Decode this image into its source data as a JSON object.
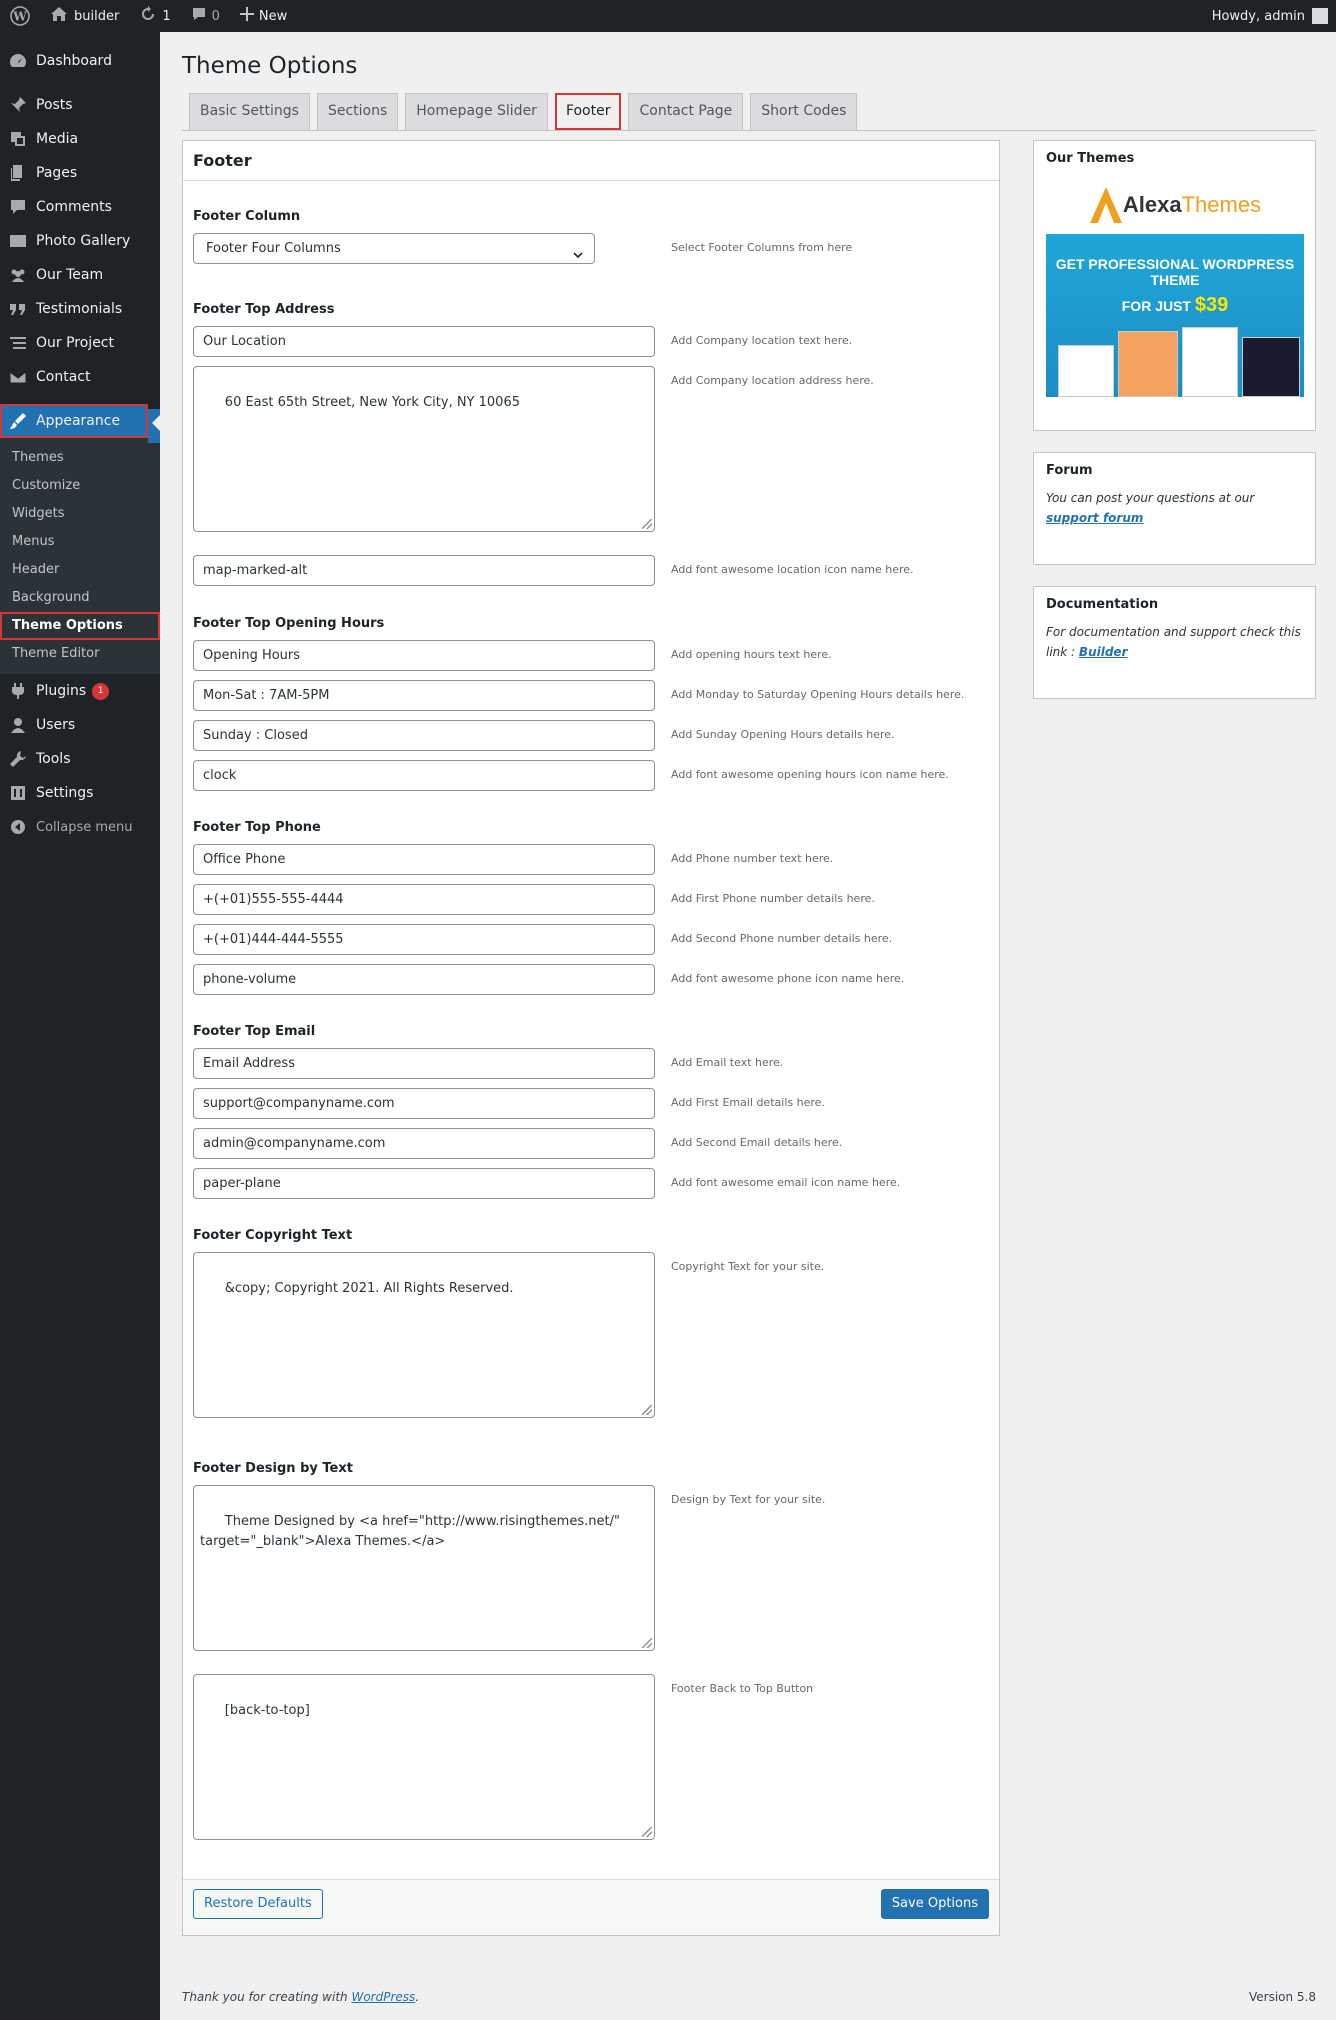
{
  "adminbar": {
    "site_name": "builder",
    "updates_count": "1",
    "comments_count": "0",
    "new_label": "New",
    "howdy": "Howdy, admin"
  },
  "sidebar": {
    "items": [
      {
        "label": "Dashboard",
        "icon": "dashboard-icon"
      },
      {
        "label": "Posts",
        "icon": "pin-icon"
      },
      {
        "label": "Media",
        "icon": "media-icon"
      },
      {
        "label": "Pages",
        "icon": "pages-icon"
      },
      {
        "label": "Comments",
        "icon": "comment-icon"
      },
      {
        "label": "Photo Gallery",
        "icon": "gallery-icon"
      },
      {
        "label": "Our Team",
        "icon": "team-icon"
      },
      {
        "label": "Testimonials",
        "icon": "quote-icon"
      },
      {
        "label": "Our Project",
        "icon": "list-icon"
      },
      {
        "label": "Contact",
        "icon": "email-icon"
      },
      {
        "label": "Appearance",
        "icon": "brush-icon"
      }
    ],
    "appearance_sub": [
      "Themes",
      "Customize",
      "Widgets",
      "Menus",
      "Header",
      "Background",
      "Theme Options",
      "Theme Editor"
    ],
    "lower_items": [
      {
        "label": "Plugins",
        "badge": "1"
      },
      {
        "label": "Users"
      },
      {
        "label": "Tools"
      },
      {
        "label": "Settings"
      }
    ],
    "collapse": "Collapse menu"
  },
  "page": {
    "title": "Theme Options",
    "tabs": [
      "Basic Settings",
      "Sections",
      "Homepage Slider",
      "Footer",
      "Contact Page",
      "Short Codes"
    ],
    "active_tab": "Footer"
  },
  "panel": {
    "heading": "Footer",
    "footer_column": {
      "label": "Footer Column",
      "value": "Footer Four Columns",
      "desc": "Select Footer Columns from here"
    },
    "address": {
      "label": "Footer Top Address",
      "text": "Our Location",
      "text_desc": "Add Company location text here.",
      "address": "60 East 65th Street, New York City, NY 10065",
      "address_desc": "Add Company location address here.",
      "icon": "map-marked-alt",
      "icon_desc": "Add font awesome location icon name here."
    },
    "hours": {
      "label": "Footer Top Opening Hours",
      "text": "Opening Hours",
      "text_desc": "Add opening hours text here.",
      "weekday": "Mon-Sat : 7AM-5PM",
      "weekday_desc": "Add Monday to Saturday Opening Hours details here.",
      "sunday": "Sunday : Closed",
      "sunday_desc": "Add Sunday Opening Hours details here.",
      "icon": "clock",
      "icon_desc": "Add font awesome opening hours icon name here."
    },
    "phone": {
      "label": "Footer Top Phone",
      "text": "Office Phone",
      "text_desc": "Add Phone number text here.",
      "first": "+(+01)555-555-4444",
      "first_desc": "Add First Phone number details here.",
      "second": "+(+01)444-444-5555",
      "second_desc": "Add Second Phone number details here.",
      "icon": "phone-volume",
      "icon_desc": "Add font awesome phone icon name here."
    },
    "email": {
      "label": "Footer Top Email",
      "text": "Email Address",
      "text_desc": "Add Email text here.",
      "first": "support@companyname.com",
      "first_desc": "Add First Email details here.",
      "second": "admin@companyname.com",
      "second_desc": "Add Second Email details here.",
      "icon": "paper-plane",
      "icon_desc": "Add font awesome email icon name here."
    },
    "copyright": {
      "label": "Footer Copyright Text",
      "value": "&copy; Copyright 2021. All Rights Reserved.",
      "desc": "Copyright Text for your site."
    },
    "design_by": {
      "label": "Footer Design by Text",
      "value": "Theme Designed by <a href=\"http://www.risingthemes.net/\"\ntarget=\"_blank\">Alexa Themes.</a>",
      "desc": "Design by Text for your site."
    },
    "back_to_top": {
      "value": "[back-to-top]",
      "desc": "Footer Back to Top Button"
    },
    "restore_label": "Restore Defaults",
    "save_label": "Save Options"
  },
  "side": {
    "themes_title": "Our Themes",
    "logo_part1": "Alexa",
    "logo_part2": "Themes",
    "banner_line1": "GET PROFESSIONAL WORDPRESS THEME",
    "banner_line2": "FOR JUST",
    "banner_price": "$39",
    "forum_title": "Forum",
    "forum_text": "You can post your questions at our",
    "forum_link": "support forum",
    "docs_title": "Documentation",
    "docs_text": "For documentation and support check this link :",
    "docs_link": "Builder"
  },
  "footer": {
    "thanks": "Thank you for creating with",
    "wp_link": "WordPress",
    "version": "Version 5.8"
  }
}
